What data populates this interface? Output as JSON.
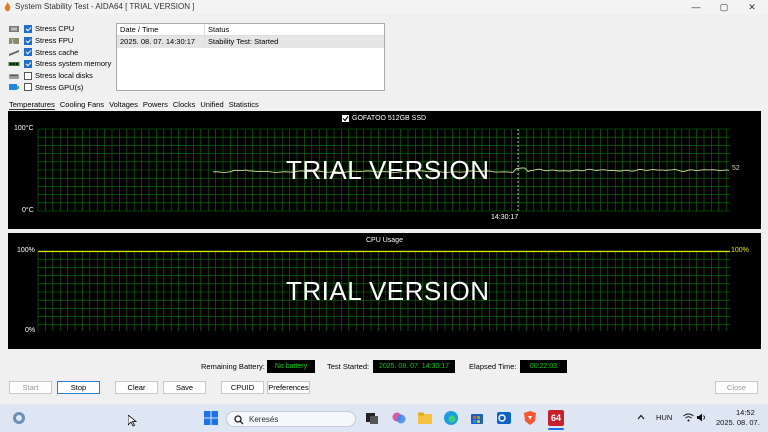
{
  "window": {
    "title": "System Stability Test - AIDA64  [ TRIAL VERSION ]",
    "controls": {
      "minimize": "—",
      "maximize": "▢",
      "close": "✕"
    }
  },
  "stress_options": [
    {
      "label": "Stress CPU",
      "checked": true
    },
    {
      "label": "Stress FPU",
      "checked": true
    },
    {
      "label": "Stress cache",
      "checked": true
    },
    {
      "label": "Stress system memory",
      "checked": true
    },
    {
      "label": "Stress local disks",
      "checked": false
    },
    {
      "label": "Stress GPU(s)",
      "checked": false
    }
  ],
  "log": {
    "headers": {
      "datetime": "Date / Time",
      "status": "Status"
    },
    "rows": [
      {
        "datetime": "2025. 08. 07. 14:30:17",
        "status": "Stability Test: Started"
      }
    ]
  },
  "tabs": [
    "Temperatures",
    "Cooling Fans",
    "Voltages",
    "Powers",
    "Clocks",
    "Unified",
    "Statistics"
  ],
  "temp_chart": {
    "legend": "GOFATOO 512GB SSD",
    "y_max_label": "100°C",
    "y_min_label": "0°C",
    "time_marker_label": "14:30:17",
    "current_value_label": "52",
    "watermark": "TRIAL VERSION",
    "line_color": "#d8d8a0",
    "grid_color": "#0b7a0b"
  },
  "cpu_chart": {
    "title": "CPU Usage",
    "y_max_label": "100%",
    "y_min_label": "0%",
    "current_value_label": "100%",
    "watermark": "TRIAL VERSION",
    "line_color": "#e5e500"
  },
  "status": {
    "battery_label": "Remaining Battery:",
    "battery_value": "No battery",
    "started_label": "Test Started:",
    "started_value": "2025. 08. 07. 14:30:17",
    "elapsed_label": "Elapsed Time:",
    "elapsed_value": "00:22:03"
  },
  "buttons": {
    "start": "Start",
    "stop": "Stop",
    "clear": "Clear",
    "save": "Save",
    "cpuid": "CPUID",
    "preferences": "Preferences",
    "close": "Close"
  },
  "taskbar": {
    "search_placeholder": "Keresés",
    "language": "HUN",
    "time": "14:52",
    "date": "2025. 08. 07.",
    "aida_badge": "64"
  }
}
